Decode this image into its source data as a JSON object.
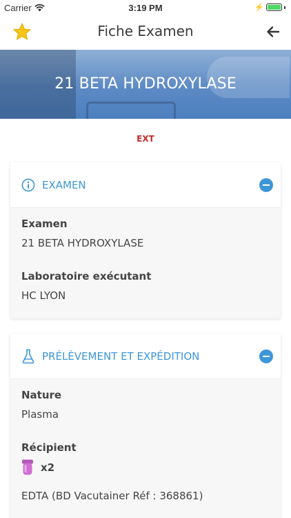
{
  "status_bar": {
    "carrier": "Carrier",
    "time": "3:19 PM"
  },
  "nav": {
    "title": "Fiche Examen"
  },
  "hero": {
    "title": "21 BETA HYDROXYLASE"
  },
  "badge": "EXT",
  "colors": {
    "accent": "#3d96d8",
    "badge": "#c62828",
    "star": "#f5c518"
  },
  "exam_card": {
    "header": "EXAMEN",
    "fields": [
      {
        "label": "Examen",
        "value": "21 BETA HYDROXYLASE"
      },
      {
        "label": "Laboratoire exécutant",
        "value": "HC LYON"
      }
    ]
  },
  "sample_card": {
    "header": "PRÉLÈVEMENT ET EXPÉDITION",
    "nature_label": "Nature",
    "nature_value": "Plasma",
    "container_label": "Récipient",
    "container_count": "x2",
    "container_name": "EDTA (BD Vacutainer Réf : 368861)"
  }
}
